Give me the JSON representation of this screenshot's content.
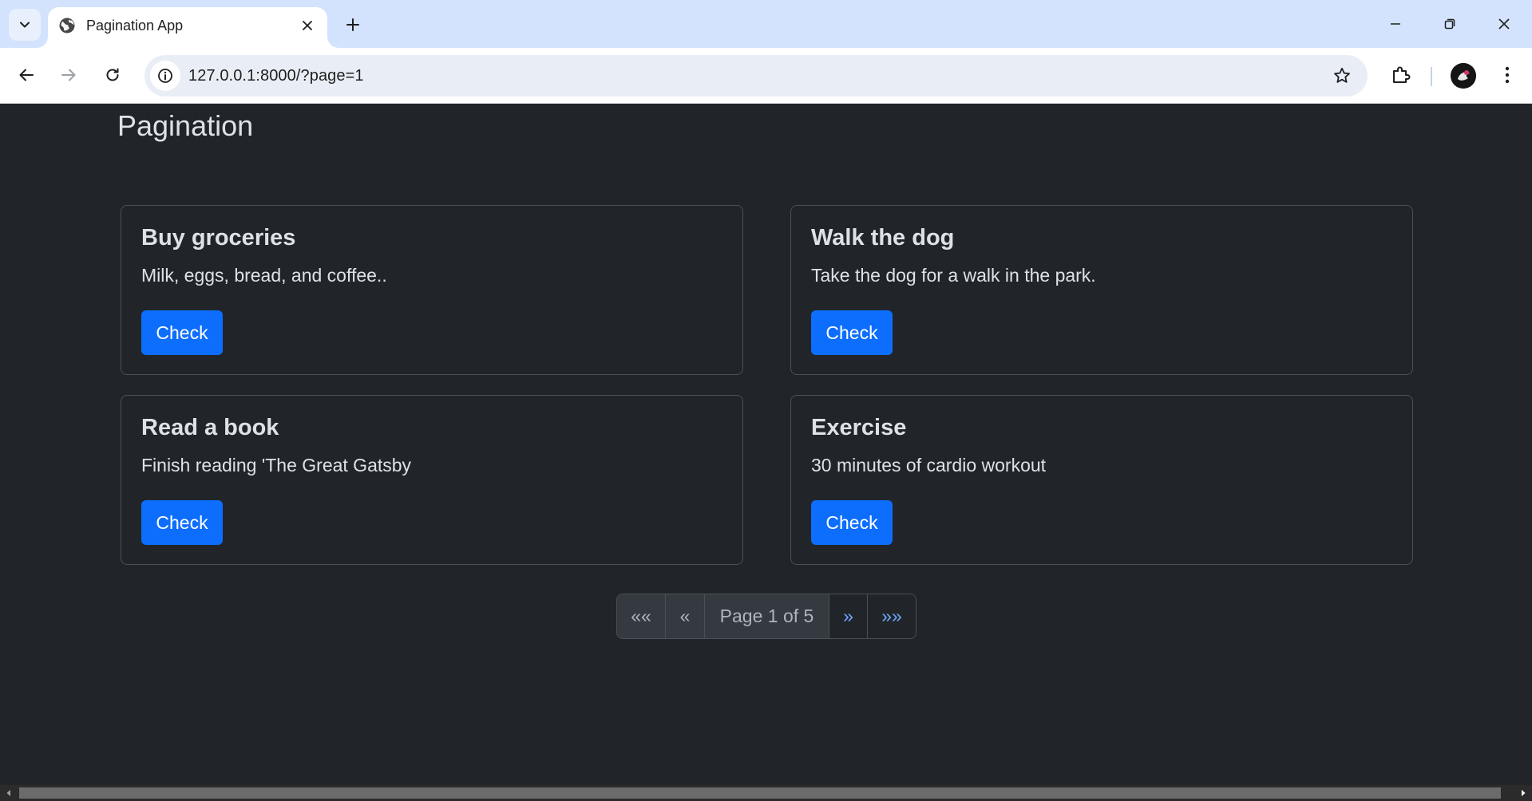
{
  "browser": {
    "tab": {
      "title": "Pagination App",
      "favicon": "globe-icon"
    },
    "url": "127.0.0.1:8000/?page=1",
    "icons": [
      "tab-search-icon",
      "close-icon",
      "plus-icon",
      "minimize-icon",
      "restore-icon",
      "close-window-icon",
      "back-icon",
      "forward-icon",
      "reload-icon",
      "info-icon",
      "star-icon",
      "extensions-icon",
      "avatar",
      "more-vert-icon"
    ]
  },
  "page": {
    "title": "Pagination",
    "cards": [
      {
        "title": "Buy groceries",
        "text": "Milk, eggs, bread, and coffee..",
        "button": "Check"
      },
      {
        "title": "Walk the dog",
        "text": "Take the dog for a walk in the park.",
        "button": "Check"
      },
      {
        "title": "Read a book",
        "text": "Finish reading 'The Great Gatsby",
        "button": "Check"
      },
      {
        "title": "Exercise",
        "text": "30 minutes of cardio workout",
        "button": "Check"
      }
    ],
    "pagination": {
      "first": "««",
      "prev": "«",
      "current": "Page 1 of 5",
      "next": "»",
      "last": "»»"
    }
  },
  "colors": {
    "background": "#212529",
    "primary_button": "#0d6efd",
    "link": "#6ea8fe",
    "card_border": "#495057",
    "tabstrip": "#d3e3fd"
  }
}
